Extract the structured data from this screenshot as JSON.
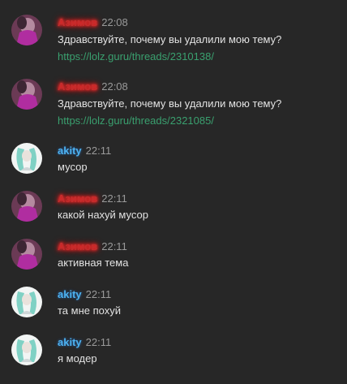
{
  "messages": [
    {
      "author": "Азимов",
      "time": "22:08",
      "text": "Здравствуйте, почему вы удалили мою тему?",
      "link": "https://lolz.guru/threads/2310138/"
    },
    {
      "author": "Азимов",
      "time": "22:08",
      "text": "Здравствуйте, почему вы удалили мою тему?",
      "link": "https://lolz.guru/threads/2321085/"
    },
    {
      "author": "akity",
      "time": "22:11",
      "text": "мусор"
    },
    {
      "author": "Азимов",
      "time": "22:11",
      "text": "какой нахуй мусор"
    },
    {
      "author": "Азимов",
      "time": "22:11",
      "text": "активная тема"
    },
    {
      "author": "akity",
      "time": "22:11",
      "text": "та мне похуй"
    },
    {
      "author": "akity",
      "time": "22:11",
      "text": "я модер"
    }
  ],
  "colors": {
    "background": "#272727",
    "text": "#e2e2e2",
    "time": "#9a9a9a",
    "link": "#3aa06f",
    "asimov_name": "#c42d2d",
    "asimov_glow": "#ff2a2a",
    "akity_name": "#4db2f0"
  }
}
